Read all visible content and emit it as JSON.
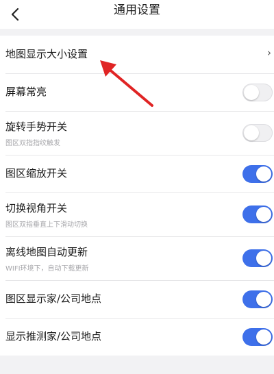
{
  "header": {
    "title": "通用设置",
    "back_icon": "chevron-left-icon"
  },
  "colors": {
    "accent": "#3e70ea",
    "annotation_arrow": "#e02424"
  },
  "settings": [
    {
      "title": "地图显示大小设置",
      "type": "link"
    },
    {
      "title": "屏幕常亮",
      "type": "toggle",
      "on": false
    },
    {
      "title": "旋转手势开关",
      "subtitle": "图区双指指纹触发",
      "type": "toggle",
      "on": false
    },
    {
      "title": "图区缩放开关",
      "type": "toggle",
      "on": true
    },
    {
      "title": "切换视角开关",
      "subtitle": "图区双指垂直上下滑动切换",
      "type": "toggle",
      "on": true
    },
    {
      "title": "离线地图自动更新",
      "subtitle": "WIFI环境下，自动下载更新",
      "type": "toggle",
      "on": true
    },
    {
      "title": "图区显示家/公司地点",
      "type": "toggle",
      "on": true
    },
    {
      "title": "显示推测家/公司地点",
      "type": "toggle",
      "on": true
    }
  ]
}
